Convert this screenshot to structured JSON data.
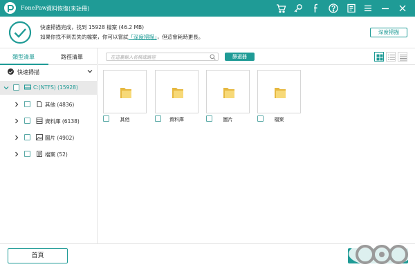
{
  "app": {
    "name": "FonePaw",
    "product": "資料恢復",
    "status": "(未註冊)"
  },
  "titlebar_icons": [
    "cart-icon",
    "key-icon",
    "facebook-icon",
    "help-icon",
    "register-icon",
    "menu-icon",
    "minimize-icon",
    "close-icon"
  ],
  "header": {
    "scan_result": "快速掃描完成，找到 15928 檔案 (46.2 MB)",
    "hint_prefix": "如果你找不到丟失的檔案，你可以嘗試",
    "hint_link": "「深度掃描」",
    "hint_suffix": "，但這會耗時更長。",
    "deep_scan_button": "深度掃描"
  },
  "sidebar": {
    "tabs": [
      {
        "label": "類型清單",
        "active": true
      },
      {
        "label": "路徑清單",
        "active": false
      }
    ],
    "scan_mode": "快速掃描",
    "drive": {
      "label": "C:(NTFS) (15928)"
    },
    "items": [
      {
        "label": "其他 (4836)",
        "icon": "file-icon"
      },
      {
        "label": "資料庫 (6138)",
        "icon": "database-icon"
      },
      {
        "label": "圖片 (4902)",
        "icon": "image-icon"
      },
      {
        "label": "檔案 (52)",
        "icon": "document-icon"
      }
    ]
  },
  "toolbar": {
    "search_placeholder": "在這裏輸入名稱或路徑",
    "filter_button": "篩選器"
  },
  "tiles": [
    {
      "label": "其他"
    },
    {
      "label": "資料庫"
    },
    {
      "label": "圖片"
    },
    {
      "label": "檔案"
    }
  ],
  "footer": {
    "home_button": "首頁"
  },
  "colors": {
    "accent": "#1f9b96",
    "folder": "#f2c94c"
  }
}
